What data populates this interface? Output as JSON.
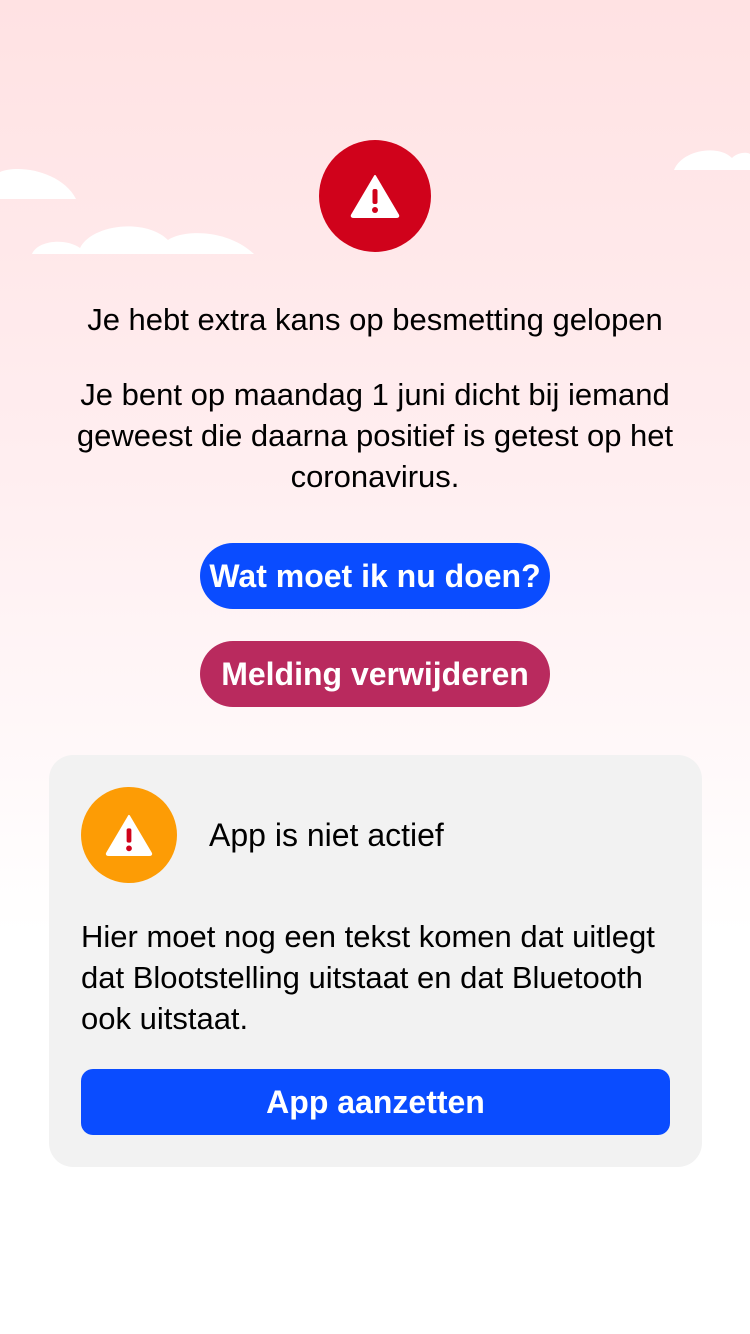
{
  "colors": {
    "alert_red": "#d0021b",
    "warning_orange": "#fd9c05",
    "primary_blue": "#0a4cff",
    "danger_pink": "#b92a5e",
    "card_background": "#f2f2f2",
    "background_top": "#ffe2e3"
  },
  "alert": {
    "icon": "warning-triangle-icon",
    "headline": "Je hebt extra kans op besmetting gelopen",
    "body": "Je bent op maandag 1 juni dicht bij iemand geweest die daarna positief is getest op het coronavirus.",
    "primary_button": "Wat moet ik nu doen?",
    "remove_button": "Melding verwijderen"
  },
  "status_card": {
    "icon": "warning-triangle-icon",
    "title": "App is niet actief",
    "text": "Hier moet nog een tekst komen dat uitlegt dat Blootstelling uitstaat en dat Bluetooth ook uitstaat.",
    "button": "App aanzetten"
  }
}
